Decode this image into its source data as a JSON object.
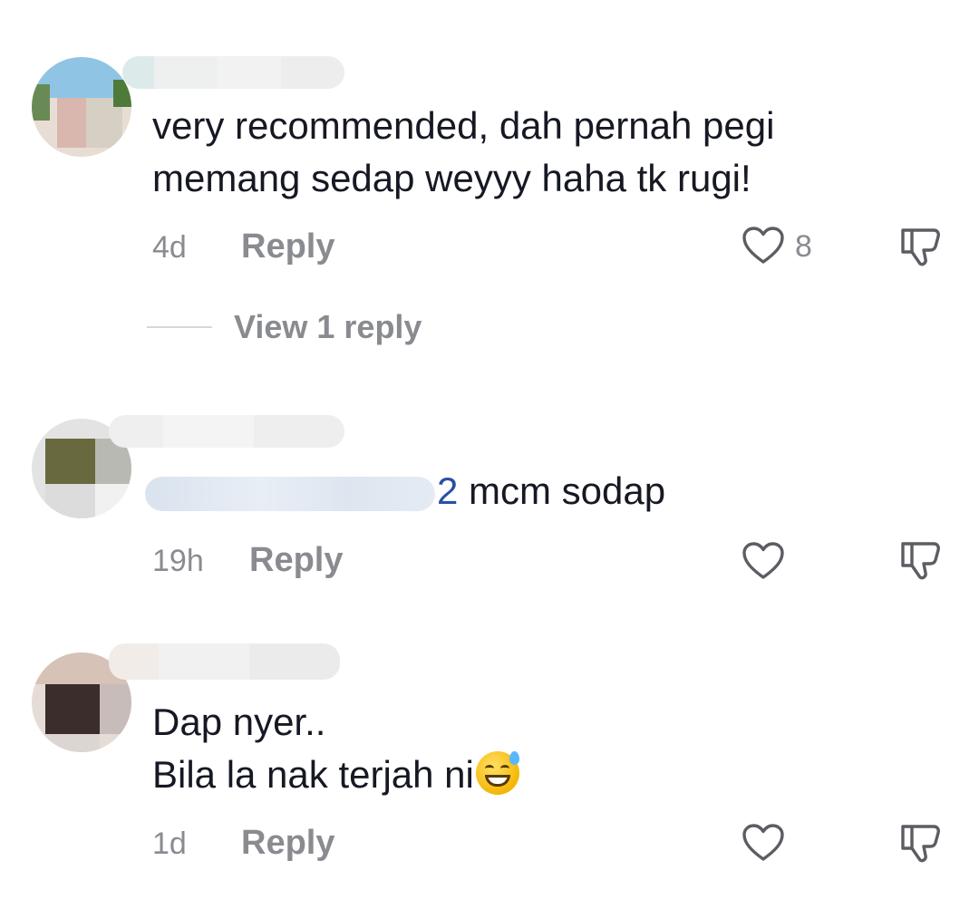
{
  "comments": [
    {
      "text_lines": [
        "very recommended, dah pernah pegi",
        "memang sedap weyyy haha tk rugi!"
      ],
      "time": "4d",
      "reply_label": "Reply",
      "like_count": "8",
      "view_replies_label": "View 1 reply"
    },
    {
      "mention_visible_suffix": "2",
      "text": " mcm sodap",
      "time": "19h",
      "reply_label": "Reply",
      "like_count": ""
    },
    {
      "text_lines": [
        "Dap nyer..",
        "Bila la nak terjah ni"
      ],
      "emoji": "grinning-face-with-sweat",
      "time": "1d",
      "reply_label": "Reply",
      "like_count": ""
    }
  ],
  "colors": {
    "text": "#161823",
    "muted": "#8a8b91",
    "mention": "#2a4fa3"
  }
}
